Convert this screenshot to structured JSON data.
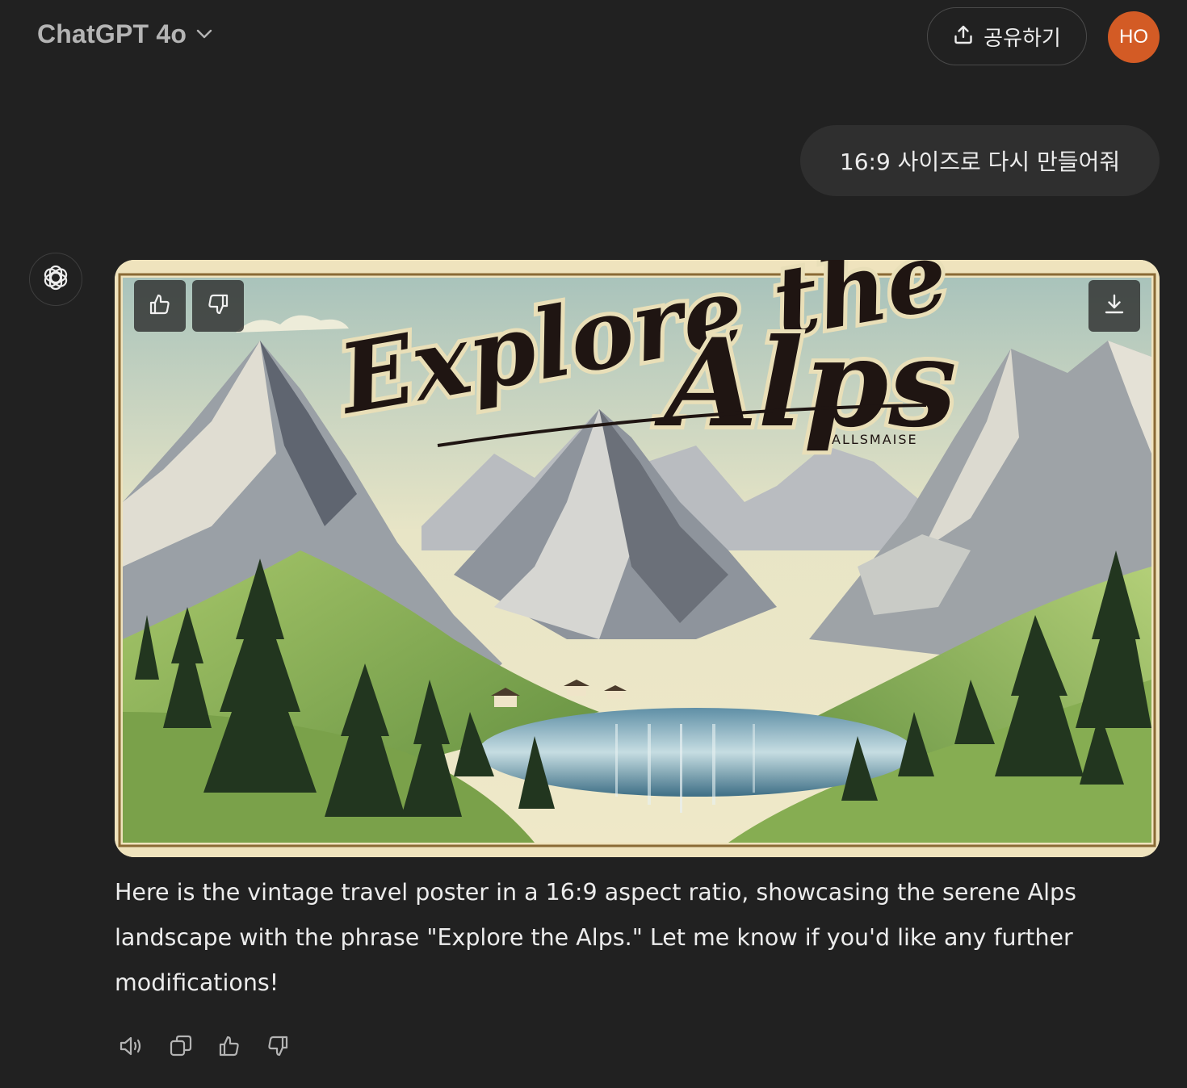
{
  "header": {
    "model_name": "ChatGPT 4o",
    "share_label": "공유하기",
    "avatar_initials": "HO",
    "avatar_color": "#d35b25"
  },
  "conversation": {
    "user_message": "16:9 사이즈로 다시 만들어줘",
    "assistant_image": {
      "title_line_1": "Explore the",
      "title_line_2": "Alps",
      "subtitle": "ALLSMAISE",
      "buttons": [
        "thumbs-up-icon",
        "thumbs-down-icon",
        "download-icon"
      ]
    },
    "assistant_text": "Here is the vintage travel poster in a 16:9 aspect ratio, showcasing the serene Alps landscape with the phrase \"Explore the Alps.\" Let me know if you'd like any further modifications!",
    "message_actions": [
      "read-aloud-icon",
      "copy-icon",
      "thumbs-up-icon",
      "thumbs-down-icon"
    ]
  },
  "colors": {
    "background": "#212121",
    "bubble": "#2f2f2f",
    "text": "#ececec",
    "muted": "#b4b4b4"
  }
}
